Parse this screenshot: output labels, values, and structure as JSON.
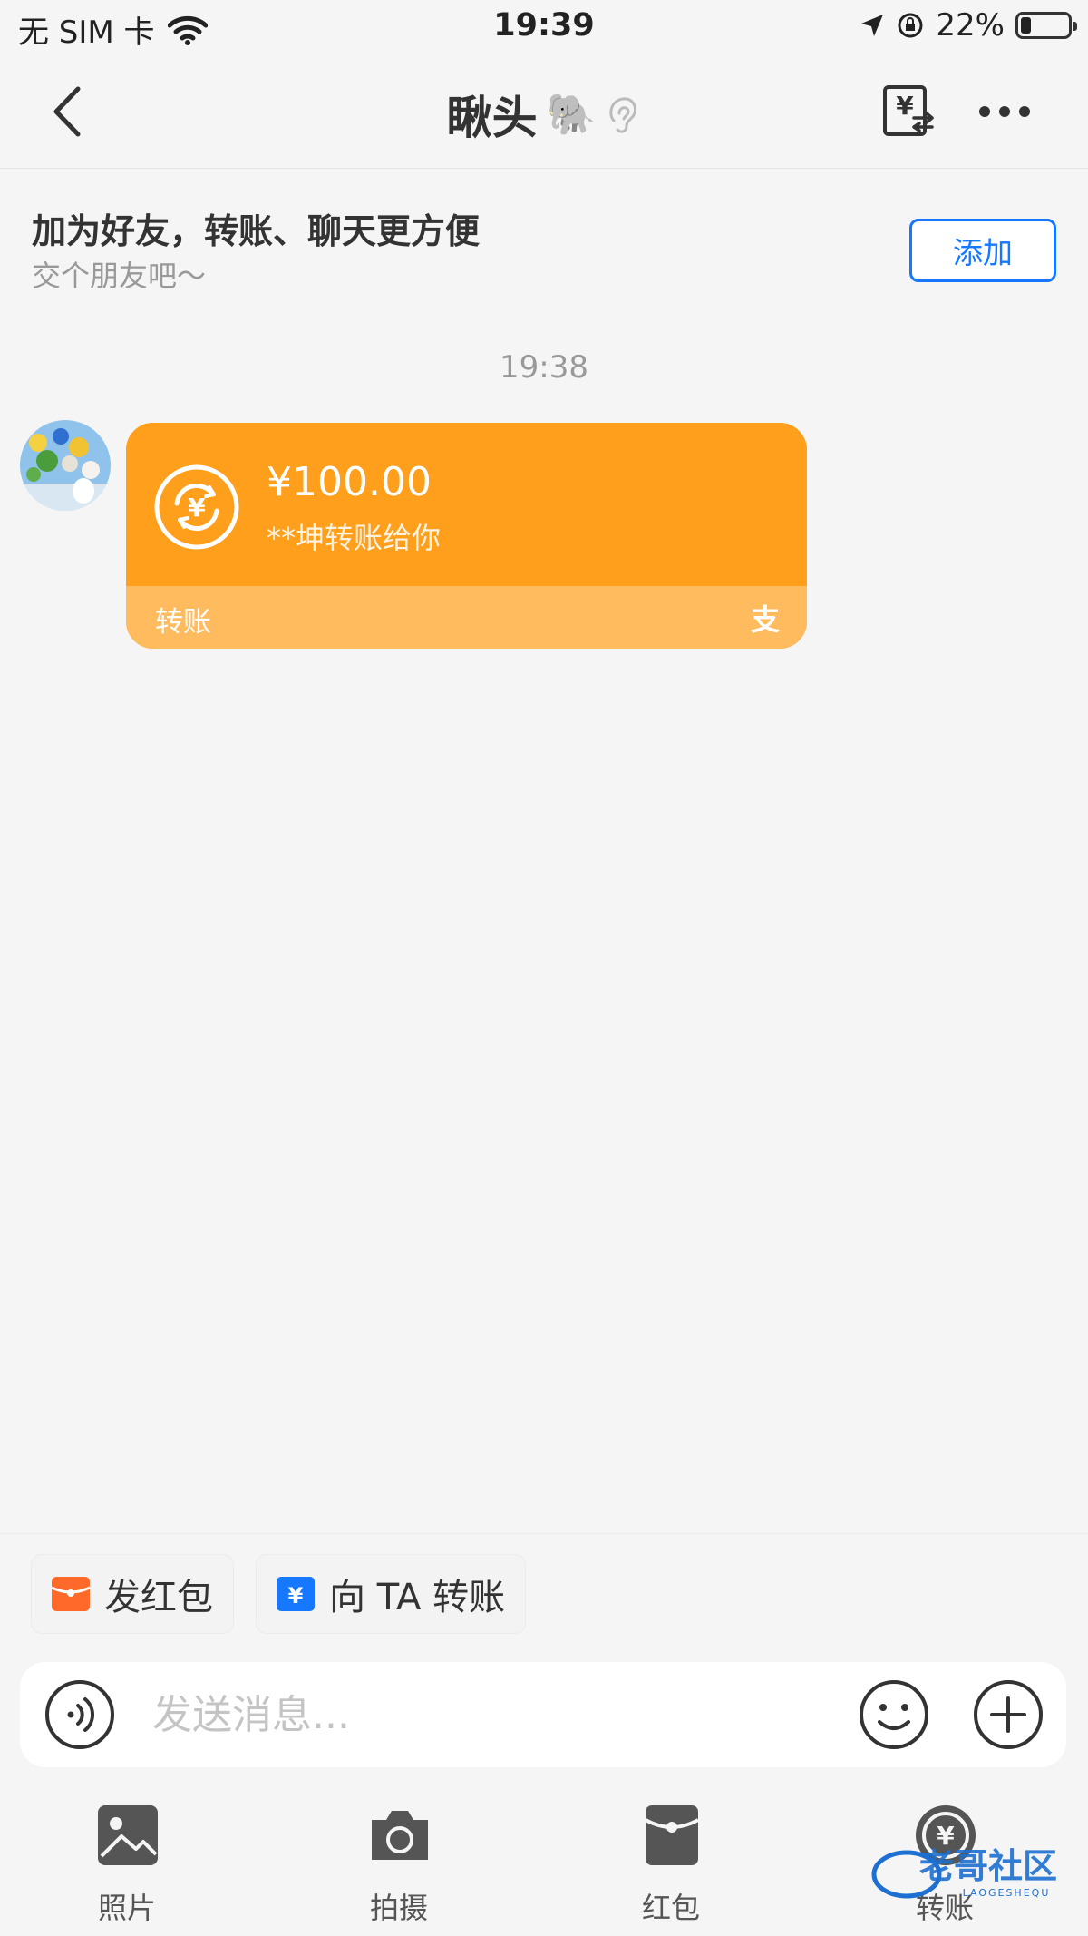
{
  "status_bar": {
    "carrier": "无 SIM 卡",
    "time": "19:39",
    "battery": "22%",
    "battery_fraction": 0.22
  },
  "nav": {
    "title": "瞅头",
    "title_emoji": "🐘"
  },
  "friend_banner": {
    "title": "加为好友，转账、聊天更方便",
    "subtitle": "交个朋友吧～",
    "add_label": "添加"
  },
  "chat": {
    "timestamp": "19:38",
    "message": {
      "amount": "¥100.00",
      "description": "**坤转账给你",
      "footer_label": "转账",
      "footer_logo": "支",
      "icon": "yuan-transfer-icon"
    }
  },
  "quick_actions": [
    {
      "label": "发红包",
      "icon": "red-envelope-icon",
      "color": "#ff6a2a"
    },
    {
      "label": "向 TA 转账",
      "icon": "transfer-yuan-icon",
      "color": "#1677ff"
    }
  ],
  "input": {
    "placeholder": "发送消息..."
  },
  "tools": [
    {
      "label": "照片",
      "icon": "photo-icon"
    },
    {
      "label": "拍摄",
      "icon": "camera-icon"
    },
    {
      "label": "红包",
      "icon": "red-envelope-icon"
    },
    {
      "label": "转账",
      "icon": "transfer-icon"
    }
  ],
  "watermark": {
    "text": "老哥社区",
    "subtext": "LAOGESHEQU"
  },
  "colors": {
    "accent_blue": "#1677ff",
    "card_orange": "#ff9f1c",
    "card_footer": "#ffbb5e",
    "background": "#f5f5f5"
  }
}
